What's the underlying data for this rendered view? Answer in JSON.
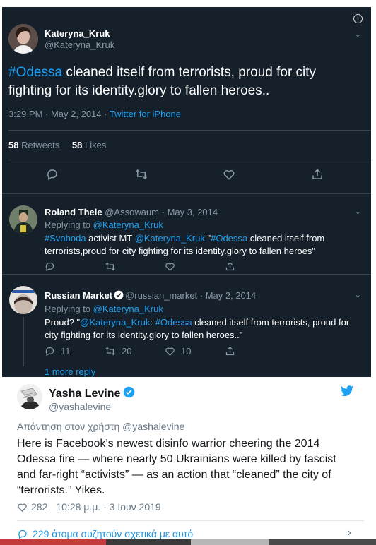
{
  "main_tweet": {
    "name": "Kateryna_Kruk",
    "handle": "@Kateryna_Kruk",
    "hashtag": "#Odessa",
    "text_rest": " cleaned itself from terrorists, proud for city fighting for its identity.glory to fallen heroes..",
    "time": "3:29 PM · May 2, 2014 · ",
    "source": "Twitter for iPhone",
    "retweets_count": "58",
    "retweets_label": " Retweets",
    "likes_count": "58",
    "likes_label": " Likes"
  },
  "replies": [
    {
      "name": "Roland Thele",
      "meta": " @Assowaum · May 3, 2014",
      "replying_label": "Replying to ",
      "replying_to": "@Kateryna_Kruk",
      "t1": "#Svoboda",
      "t2": " activist MT ",
      "t3": "@Kateryna_Kruk",
      "t4": " \"",
      "t5": "#Odessa",
      "t6": " cleaned itself from terrorists,proud for city fighting for its identity.glory to fallen heroes\""
    },
    {
      "name": "Russian Market",
      "meta": "@russian_market · May 2, 2014",
      "replying_label": "Replying to ",
      "replying_to": "@Kateryna_Kruk",
      "t1": "Proud? \"",
      "t2": "@Kateryna_Kruk",
      "t3": ": ",
      "t4": "#Odessa",
      "t5": " cleaned itself from terrorists, proud for city fighting for its identity.glory to fallen heroes..\"",
      "replies_count": "11",
      "retweets_count": "20",
      "likes_count": "10"
    }
  ],
  "more_reply": "1 more reply",
  "embed": {
    "name": "Yasha Levine",
    "handle": "@yashalevine",
    "reply_to": "Απάντηση στον χρήστη @yashalevine",
    "text": "Here is Facebook’s newest disinfo warrior cheering the 2014 Odessa fire — where nearly 50 Ukrainians were killed by fascist and far-right “activists”  — as an action that “cleaned” the city of “terrorists.” Yikes.",
    "likes": "282",
    "time": "10:28 μ.μ. - 3 Ιουν 2019",
    "discussion": "229 άτομα συζητούν σχετικά με αυτό"
  },
  "colors": {
    "dark_bg": "#15202b",
    "twitter_blue": "#1da1f2",
    "muted": "#8899a6",
    "divider": "#38444d"
  }
}
